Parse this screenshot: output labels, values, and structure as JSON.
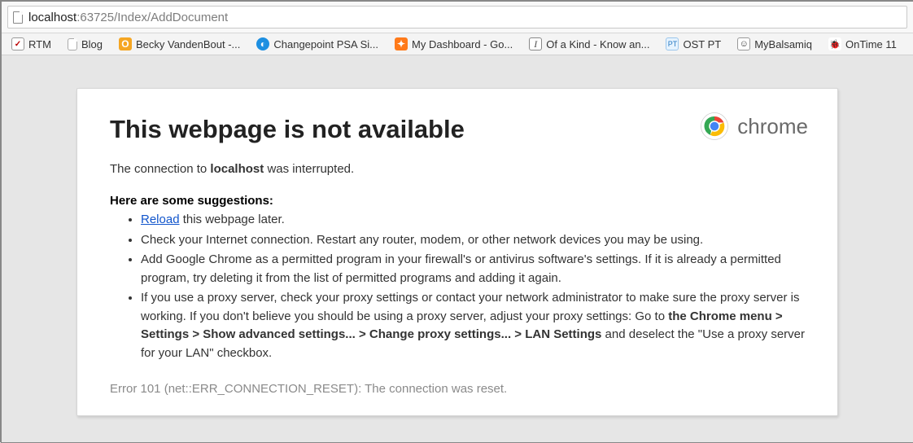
{
  "address": {
    "host": "localhost",
    "path": ":63725/Index/AddDocument"
  },
  "bookmarks": [
    {
      "label": "RTM"
    },
    {
      "label": "Blog"
    },
    {
      "label": "Becky VandenBout -..."
    },
    {
      "label": "Changepoint PSA Si..."
    },
    {
      "label": "My Dashboard - Go..."
    },
    {
      "label": "Of a Kind - Know an..."
    },
    {
      "label": "OST PT"
    },
    {
      "label": "MyBalsamiq"
    },
    {
      "label": "OnTime 11"
    }
  ],
  "page": {
    "brand": "chrome",
    "title": "This webpage is not available",
    "conn_prefix": "The connection to ",
    "conn_host": "localhost",
    "conn_suffix": " was interrupted.",
    "sugg_head": "Here are some suggestions:",
    "reload_text": "Reload",
    "reload_suffix": " this webpage later.",
    "sugg2": "Check your Internet connection. Restart any router, modem, or other network devices you may be using.",
    "sugg3": "Add Google Chrome as a permitted program in your firewall's or antivirus software's settings. If it is already a permitted program, try deleting it from the list of permitted programs and adding it again.",
    "sugg4_pre": "If you use a proxy server, check your proxy settings or contact your network administrator to make sure the proxy server is working. If you don't believe you should be using a proxy server, adjust your proxy settings: Go to ",
    "sugg4_bold": "the Chrome menu > Settings > Show advanced settings... > Change proxy settings... > LAN Settings",
    "sugg4_post": " and deselect the \"Use a proxy server for your LAN\" checkbox.",
    "error": "Error 101 (net::ERR_CONNECTION_RESET): The connection was reset."
  }
}
